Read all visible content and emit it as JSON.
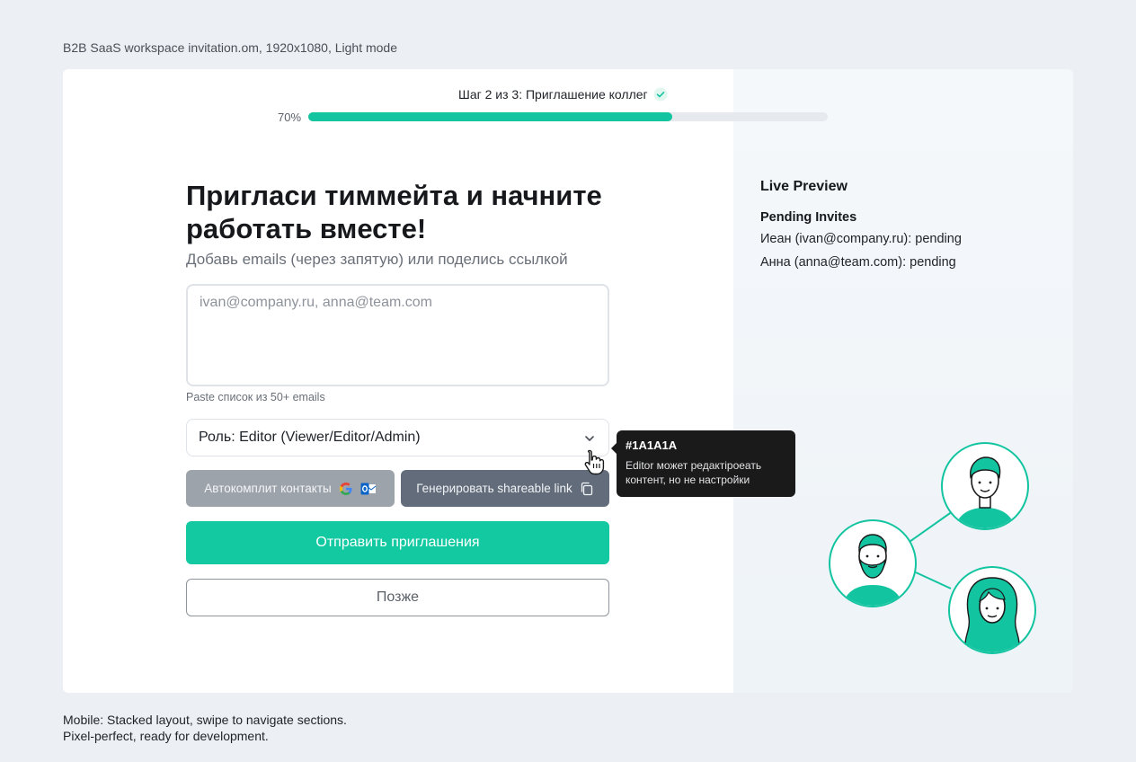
{
  "captions": {
    "top": "B2B SaaS workspace invitation.om, 1920x1080, Light mode",
    "bottom_line1": "Mobile: Stacked layout, swipe to navigate sections.",
    "bottom_line2": "Pixel-perfect, ready for development."
  },
  "progress": {
    "step_label": "Шаг 2 из 3: Приглашение коллег",
    "percent_label": "70%",
    "percent": 70,
    "accent_color": "#13c4a0"
  },
  "form": {
    "headline": "Пригласи тиммейта и начните работать вместе!",
    "subhead": "Добавь emails (через запятую) или поделись ссылкой",
    "email_placeholder": "ivan@company.ru, anna@team.com",
    "paste_hint": "Paste список из 50+ emails",
    "role_select_value": "Роль: Editor (Viewer/Editor/Admin)",
    "autocomplete_label": "Автокомплит контакты",
    "shareable_label": "Генерировать shareable link",
    "send_label": "Отправить приглашения",
    "later_label": "Позже"
  },
  "tooltip": {
    "title": "#1A1A1A",
    "body": "Editor может редактiроеать контент, но не настройки"
  },
  "preview": {
    "title": "Live Preview",
    "pending_title": "Pending Invites",
    "invites": [
      {
        "text": "Иеан (ivan@company.ru): pending"
      },
      {
        "text": "Анна (anna@team.com): pending"
      }
    ]
  },
  "icons": {
    "step_check": "check-icon",
    "chevron": "chevron-down-icon",
    "cursor": "hand-pointer-icon",
    "google": "google-icon",
    "outlook": "outlook-icon",
    "copy": "copy-icon"
  }
}
